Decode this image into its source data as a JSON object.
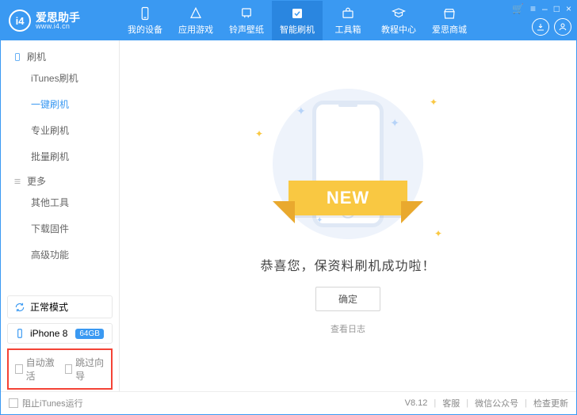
{
  "app": {
    "name": "爱思助手",
    "url": "www.i4.cn",
    "logo_icon": "i4"
  },
  "window_controls": {
    "cart": "🛒",
    "menu": "≡",
    "min": "–",
    "max": "□",
    "close": "×"
  },
  "nav": [
    {
      "label": "我的设备",
      "icon": "device"
    },
    {
      "label": "应用游戏",
      "icon": "apps"
    },
    {
      "label": "铃声壁纸",
      "icon": "music"
    },
    {
      "label": "智能刷机",
      "icon": "flash",
      "active": true
    },
    {
      "label": "工具箱",
      "icon": "toolbox"
    },
    {
      "label": "教程中心",
      "icon": "tutorial"
    },
    {
      "label": "爱思商城",
      "icon": "shop"
    }
  ],
  "sidebar": {
    "group1": {
      "title": "刷机",
      "items": [
        "iTunes刷机",
        "一键刷机",
        "专业刷机",
        "批量刷机"
      ],
      "active_index": 1
    },
    "group2": {
      "title": "更多",
      "items": [
        "其他工具",
        "下载固件",
        "高级功能"
      ]
    }
  },
  "device_box": {
    "mode_label": "正常模式",
    "phone_label": "iPhone 8",
    "storage_badge": "64GB"
  },
  "auto_options": {
    "auto_activate": "自动激活",
    "skip_guide": "跳过向导"
  },
  "main": {
    "ribbon_text": "NEW",
    "success_msg": "恭喜您，保资料刷机成功啦！",
    "ok_btn": "确定",
    "log_link": "查看日志"
  },
  "statusbar": {
    "block_itunes": "阻止iTunes运行",
    "version": "V8.12",
    "support": "客服",
    "wechat": "微信公众号",
    "check_update": "检查更新"
  }
}
